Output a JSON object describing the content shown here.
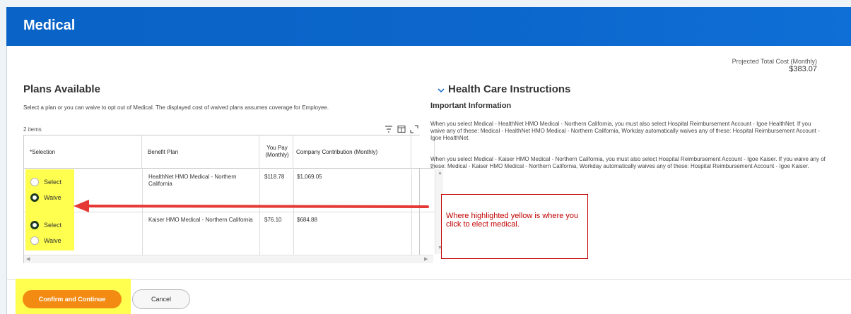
{
  "header": {
    "title": "Medical"
  },
  "projected": {
    "label": "Projected Total Cost (Monthly)",
    "value": "$383.07"
  },
  "plans": {
    "title": "Plans Available",
    "description": "Select a plan or you can waive to opt out of Medical. The displayed cost of waived plans assumes coverage for Employee.",
    "count": "2 items",
    "columns": [
      "*Selection",
      "Benefit Plan",
      "You Pay (Monthly)",
      "Company Contribution (Monthly)"
    ],
    "rows": [
      {
        "plan": "HealthNet HMO Medical - Northern California",
        "you_pay": "$118.78",
        "company": "$1,069.05",
        "option_select": "Select",
        "option_waive": "Waive",
        "selected": "Waive"
      },
      {
        "plan": "Kaiser HMO Medical - Northern California",
        "you_pay": "$76.10",
        "company": "$684.88",
        "option_select": "Select",
        "option_waive": "Waive",
        "selected": "Select"
      }
    ]
  },
  "instructions": {
    "title": "Health Care Instructions",
    "subtitle": "Important Information",
    "para1": "When you select Medical - HealthNet HMO Medical - Northern California, you must also select Hospital Reimbursement Account - Igoe HealthNet. If you waive any of these: Medical - HealthNet HMO Medical - Northern California, Workday automatically waives any of these: Hospital Reimbursement Account - Igoe HealthNet.",
    "para2": "When you select Medical - Kaiser HMO Medical - Northern California, you must also select Hospital Reimbursement Account - Igoe Kaiser. If you waive any of these: Medical - Kaiser HMO Medical - Northern California, Workday automatically waives any of these: Hospital Reimbursement Account - Igoe Kaiser."
  },
  "callout": {
    "text": "Where highlighted yellow is where you click to elect medical."
  },
  "footer": {
    "confirm_label": "Confirm and Continue",
    "cancel_label": "Cancel"
  },
  "colors": {
    "header": "#0c67cc",
    "highlight": "#ffff4f",
    "confirm": "#f38b12",
    "arrow": "#e53935",
    "callout": "#c00000"
  },
  "icons": [
    "filter-icon",
    "columns-icon",
    "expand-icon",
    "chevron-down-icon",
    "arrow-left-icon"
  ]
}
